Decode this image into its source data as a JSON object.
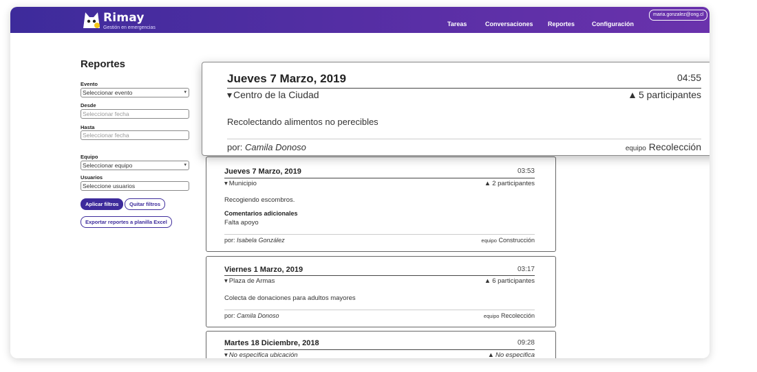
{
  "app": {
    "name": "Rimay",
    "subtitle": "Gestión en emergencias"
  },
  "nav": {
    "tareas": "Tareas",
    "conversaciones": "Conversaciones",
    "reportes": "Reportes",
    "configuracion": "Configuración"
  },
  "user": {
    "email": "maria.gonzalez@ong.cl"
  },
  "colors": {
    "brand": "#3d2b9b",
    "brand_end": "#6a32ac"
  },
  "filters": {
    "title": "Reportes",
    "evento_label": "Evento",
    "evento_value": "Seleccionar evento",
    "desde_label": "Desde",
    "desde_placeholder": "Seleccionar fecha",
    "hasta_label": "Hasta",
    "hasta_placeholder": "Seleccionar fecha",
    "equipo_label": "Equipo",
    "equipo_value": "Seleccionar equipo",
    "usuarios_label": "Usuarios",
    "usuarios_value": "Seleccione usuarios",
    "apply": "Aplicar filtros",
    "clear": "Quitar filtros",
    "export": "Exportar reportes a planilla Excel"
  },
  "popup": {
    "date": "Jueves 7 Marzo, 2019",
    "time": "04:55",
    "location": "Centro de la Ciudad",
    "participants": "5 participantes",
    "description": "Recolectando alimentos no perecibles",
    "by_prefix": "por:",
    "author": "Camila Donoso",
    "team_prefix": "equipo",
    "team": "Recolección"
  },
  "reports": [
    {
      "date": "Jueves 7 Marzo, 2019",
      "time": "03:53",
      "location": "Municipio",
      "participants": "2 participantes",
      "description": "Recogiendo escombros.",
      "comments_label": "Comentarios adicionales",
      "comments": "Falta apoyo",
      "by_prefix": "por:",
      "author": "Isabela González",
      "team_prefix": "equipo",
      "team": "Construcción"
    },
    {
      "date": "Viernes 1 Marzo, 2019",
      "time": "03:17",
      "location": "Plaza de Armas",
      "participants": "6 participantes",
      "description": "Colecta de donaciones para adultos mayores",
      "by_prefix": "por:",
      "author": "Camila Donoso",
      "team_prefix": "equipo",
      "team": "Recolección"
    },
    {
      "date": "Martes 18 Diciembre, 2018",
      "time": "09:28",
      "location": "No especifica ubicación",
      "participants": "No especifica"
    }
  ]
}
